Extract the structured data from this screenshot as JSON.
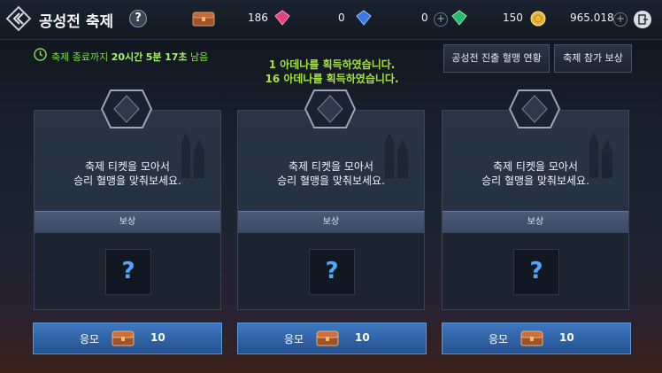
{
  "header": {
    "title": "공성전 축제",
    "help_icon": "?",
    "resources": [
      {
        "icon": "chest-icon",
        "value": "186"
      },
      {
        "icon": "pink-gem-icon",
        "value": "0"
      },
      {
        "icon": "blue-gem-icon",
        "value": "0"
      },
      {
        "icon": "green-gem-icon",
        "value": "150"
      },
      {
        "icon": "gold-coin-icon",
        "value": "965.018"
      }
    ]
  },
  "timer": {
    "prefix": "축제 종료까지",
    "hours": "20시간",
    "minutes": "5분",
    "seconds": "17초",
    "suffix": "남음"
  },
  "notices": [
    "1 아데나를 획득하였습니다.",
    "16 아데나를 획득하였습니다."
  ],
  "buttons": {
    "status": "공성전 진출 혈맹 연황",
    "reward": "축제 참가 보상"
  },
  "cards": [
    {
      "text_1": "축제 티켓을 모아서",
      "text_2": "승리 혈맹을 맞춰보세요.",
      "reward_label": "보상",
      "reward_item": "?",
      "apply_label": "응모",
      "apply_cost": "10"
    },
    {
      "text_1": "축제 티켓을 모아서",
      "text_2": "승리 혈맹을 맞춰보세요.",
      "reward_label": "보상",
      "reward_item": "?",
      "apply_label": "응모",
      "apply_cost": "10"
    },
    {
      "text_1": "축제 티켓을 모아서",
      "text_2": "승리 혈맹을 맞춰보세요.",
      "reward_label": "보상",
      "reward_item": "?",
      "apply_label": "응모",
      "apply_cost": "10"
    }
  ],
  "colors": {
    "accent_green": "#a6e23a",
    "apply_blue": "#3e78c0",
    "question_blue": "#4fa8ff"
  }
}
